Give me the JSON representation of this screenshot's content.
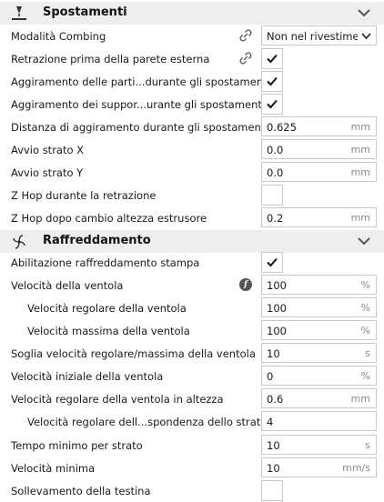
{
  "sections": {
    "travel": {
      "title": "Spostamenti",
      "icon": "travel-icon"
    },
    "cooling": {
      "title": "Raffreddamento",
      "icon": "fan-icon"
    }
  },
  "rows": [
    {
      "label": "Modalità Combing",
      "value": "Non nel rivestime...",
      "icon": "link-icon"
    },
    {
      "label": "Retrazione prima della parete esterna",
      "checked": true,
      "icon": "link-icon"
    },
    {
      "label": "Aggiramento delle parti...durante gli spostamenti",
      "checked": true
    },
    {
      "label": "Aggiramento dei suppor...urante gli spostamenti",
      "checked": true
    },
    {
      "label": "Distanza di aggiramento durante gli spostamenti",
      "value": "0.625",
      "unit": "mm"
    },
    {
      "label": "Avvio strato X",
      "value": "0.0",
      "unit": "mm"
    },
    {
      "label": "Avvio strato Y",
      "value": "0.0",
      "unit": "mm"
    },
    {
      "label": "Z Hop durante la retrazione",
      "checked": false
    },
    {
      "label": "Z Hop dopo cambio altezza estrusore",
      "value": "0.2",
      "unit": "mm"
    },
    {
      "label": "Abilitazione raffreddamento stampa",
      "checked": true
    },
    {
      "label": "Velocità della ventola",
      "value": "100",
      "unit": "%",
      "icon": "function-icon",
      "icon_glyph": "f"
    },
    {
      "label": "Velocità regolare della ventola",
      "value": "100",
      "unit": "%"
    },
    {
      "label": "Velocità massima della ventola",
      "value": "100",
      "unit": "%"
    },
    {
      "label": "Soglia velocità regolare/massima della ventola",
      "value": "10",
      "unit": "s"
    },
    {
      "label": "Velocità iniziale della ventola",
      "value": "0",
      "unit": "%"
    },
    {
      "label": "Velocità regolare della ventola in altezza",
      "value": "0.6",
      "unit": "mm"
    },
    {
      "label": "Velocità regolare dell...spondenza dello strato",
      "value": "4",
      "unit": ""
    },
    {
      "label": "Tempo minimo per strato",
      "value": "10",
      "unit": "s"
    },
    {
      "label": "Velocità minima",
      "value": "10",
      "unit": "mm/s"
    },
    {
      "label": "Sollevamento della testina",
      "checked": false
    }
  ]
}
